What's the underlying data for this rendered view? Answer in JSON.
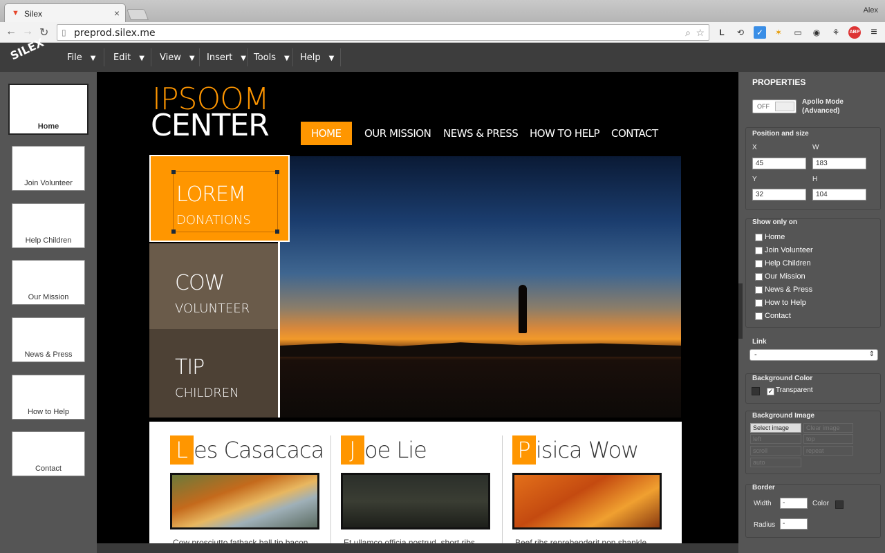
{
  "browser": {
    "tab_title": "Silex",
    "user": "Alex",
    "url": "preprod.silex.me",
    "ext_icons": [
      "L",
      "⟲",
      "✓",
      "✶",
      "▭",
      "◉",
      "⚘",
      "ABP",
      "≡"
    ]
  },
  "menu": {
    "logo": "SILEX",
    "items": [
      "File",
      "Edit",
      "View",
      "Insert",
      "Tools",
      "Help"
    ]
  },
  "pages": [
    "Home",
    "Join Volunteer",
    "Help Children",
    "Our Mission",
    "News & Press",
    "How to Help",
    "Contact"
  ],
  "site": {
    "title_a": "IPSOOM",
    "title_b": "CENTER",
    "nav": [
      "HOME",
      "OUR MISSION",
      "NEWS & PRESS",
      "HOW TO HELP",
      "CONTACT"
    ],
    "blocks": [
      {
        "a": "LOREM",
        "b": "DONATIONS"
      },
      {
        "a": "COW",
        "b": "VOLUNTEER"
      },
      {
        "a": "TIP",
        "b": "CHILDREN"
      }
    ],
    "columns": [
      {
        "cap": "L",
        "rest": "es Casacaca",
        "text": "Cow prosciutto fatback ball tip bacon"
      },
      {
        "cap": "J",
        "rest": "oe Lie",
        "text": "Et ullamco officia nostrud, short ribs"
      },
      {
        "cap": "P",
        "rest": "isica Wow",
        "text": "Beef ribs reprehenderit non shankle"
      }
    ]
  },
  "props": {
    "title": "PROPERTIES",
    "toggle": "OFF",
    "apollo_l1": "Apollo Mode",
    "apollo_l2": "(Advanced)",
    "pos_title": "Position and size",
    "x_label": "X",
    "w_label": "W",
    "y_label": "Y",
    "h_label": "H",
    "x": "45",
    "w": "183",
    "y": "32",
    "h": "104",
    "show_title": "Show only on",
    "link_title": "Link",
    "link_value": "-",
    "bgc_title": "Background Color",
    "transparent": "Transparent",
    "bgi_title": "Background Image",
    "select_image": "Select image",
    "clear_image": "Clear image",
    "dim_opts": [
      "left",
      "top",
      "scroll",
      "repeat",
      "auto"
    ],
    "border_title": "Border",
    "width_label": "Width",
    "color_label": "Color",
    "radius_label": "Radius",
    "border_width": "-",
    "border_radius": "-"
  }
}
